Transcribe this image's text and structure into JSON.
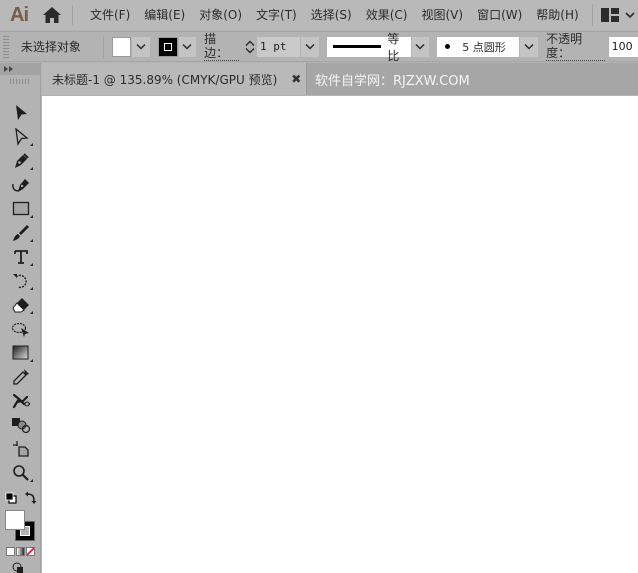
{
  "app": {
    "logo": "Ai",
    "colors": {
      "chrome": "#b9b9b9",
      "panel": "#b3b3b3",
      "tabbar": "#a6a6a6",
      "canvas": "#ffffff",
      "logo": "#7a5a48"
    }
  },
  "menubar": {
    "items": [
      {
        "label": "文件(F)"
      },
      {
        "label": "编辑(E)"
      },
      {
        "label": "对象(O)"
      },
      {
        "label": "文字(T)"
      },
      {
        "label": "选择(S)"
      },
      {
        "label": "效果(C)"
      },
      {
        "label": "视图(V)"
      },
      {
        "label": "窗口(W)"
      },
      {
        "label": "帮助(H)"
      }
    ],
    "icons": {
      "home": "home-icon",
      "workspace": "workspace-layout-icon"
    }
  },
  "controlbar": {
    "selection_status": "未选择对象",
    "fill_color": "#ffffff",
    "stroke_color": "#000000",
    "stroke_label": "描边：",
    "stroke_weight": "1 pt",
    "variable_width_profile": "等比",
    "brush_definition": "5 点圆形",
    "brush_size_prefix": "5",
    "brush_name": "点圆形",
    "opacity_label": "不透明度：",
    "opacity_value": "100"
  },
  "tabs": [
    {
      "label": "未标题-1 @ 135.89% (CMYK/GPU 预览)",
      "active": true,
      "close": "✖"
    },
    {
      "label": "软件自学网：RJZXW.COM",
      "active": false
    }
  ],
  "toolbar": {
    "tools": [
      {
        "name": "selection-tool",
        "icon": "selection-arrow-icon",
        "has_submenu": false
      },
      {
        "name": "direct-selection-tool",
        "icon": "direct-selection-arrow-icon",
        "has_submenu": true
      },
      {
        "name": "pen-tool",
        "icon": "pen-icon",
        "has_submenu": true
      },
      {
        "name": "curvature-tool",
        "icon": "curvature-pen-icon",
        "has_submenu": false
      },
      {
        "name": "rectangle-tool",
        "icon": "rectangle-icon",
        "has_submenu": true
      },
      {
        "name": "paintbrush-tool",
        "icon": "paintbrush-icon",
        "has_submenu": true
      },
      {
        "name": "type-tool",
        "icon": "type-icon",
        "has_submenu": true
      },
      {
        "name": "rotate-tool",
        "icon": "rotate-icon",
        "has_submenu": true
      },
      {
        "name": "eraser-tool",
        "icon": "eraser-icon",
        "has_submenu": true
      },
      {
        "name": "lasso-tool",
        "icon": "lasso-icon",
        "has_submenu": false
      },
      {
        "name": "gradient-tool",
        "icon": "gradient-icon",
        "has_submenu": true
      },
      {
        "name": "eyedropper-tool",
        "icon": "eyedropper-icon",
        "has_submenu": false
      },
      {
        "name": "puppet-warp-tool",
        "icon": "puppet-warp-icon",
        "has_submenu": false
      },
      {
        "name": "shape-builder-tool",
        "icon": "shape-builder-icon",
        "has_submenu": false
      },
      {
        "name": "artboard-tool",
        "icon": "artboard-icon",
        "has_submenu": false
      },
      {
        "name": "zoom-tool",
        "icon": "zoom-icon",
        "has_submenu": true
      }
    ],
    "fill_color": "#ffffff",
    "stroke_color": "#000000"
  }
}
